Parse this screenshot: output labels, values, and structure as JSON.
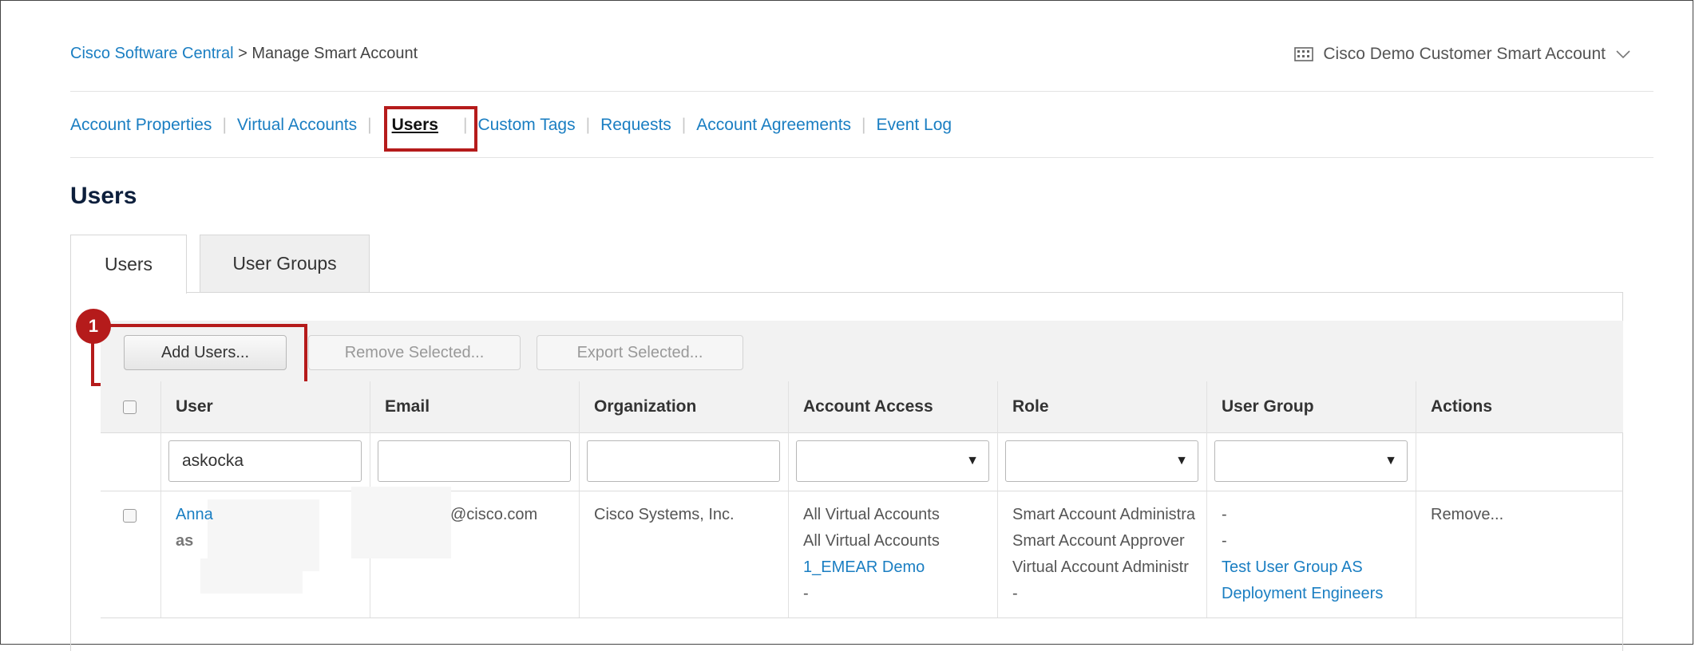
{
  "breadcrumb": {
    "root": "Cisco Software Central",
    "separator": ">",
    "current": "Manage Smart Account"
  },
  "account": {
    "name": "Cisco Demo Customer Smart Account",
    "icon": "building-icon",
    "chevron": "chevron-down-icon"
  },
  "nav": {
    "items": [
      "Account Properties",
      "Virtual Accounts",
      "Users",
      "Custom Tags",
      "Requests",
      "Account Agreements",
      "Event Log"
    ],
    "active": "Users"
  },
  "page": {
    "title": "Users"
  },
  "tabs": {
    "users": "Users",
    "user_groups": "User Groups"
  },
  "step_badge": "1",
  "toolbar": {
    "add": "Add Users...",
    "remove": "Remove Selected...",
    "export": "Export Selected..."
  },
  "table": {
    "headers": [
      "User",
      "Email",
      "Organization",
      "Account Access",
      "Role",
      "User Group",
      "Actions"
    ],
    "filters": {
      "user": "askocka",
      "email": "",
      "organization": ""
    },
    "rows": [
      {
        "user_name": "Anna",
        "user_id": "as",
        "email": "@cisco.com",
        "organization": "Cisco Systems, Inc.",
        "access": [
          "All Virtual Accounts",
          "All Virtual Accounts",
          "1_EMEAR Demo",
          "-"
        ],
        "roles": [
          "Smart Account Administra",
          "Smart Account Approver",
          "Virtual Account Administr",
          "-"
        ],
        "groups": [
          "-",
          "-",
          "Test User Group AS",
          "Deployment Engineers"
        ],
        "action": "Remove..."
      }
    ]
  },
  "colors": {
    "link": "#1a7ec2",
    "highlight": "#b51b1b",
    "title": "#0d1f3c"
  }
}
